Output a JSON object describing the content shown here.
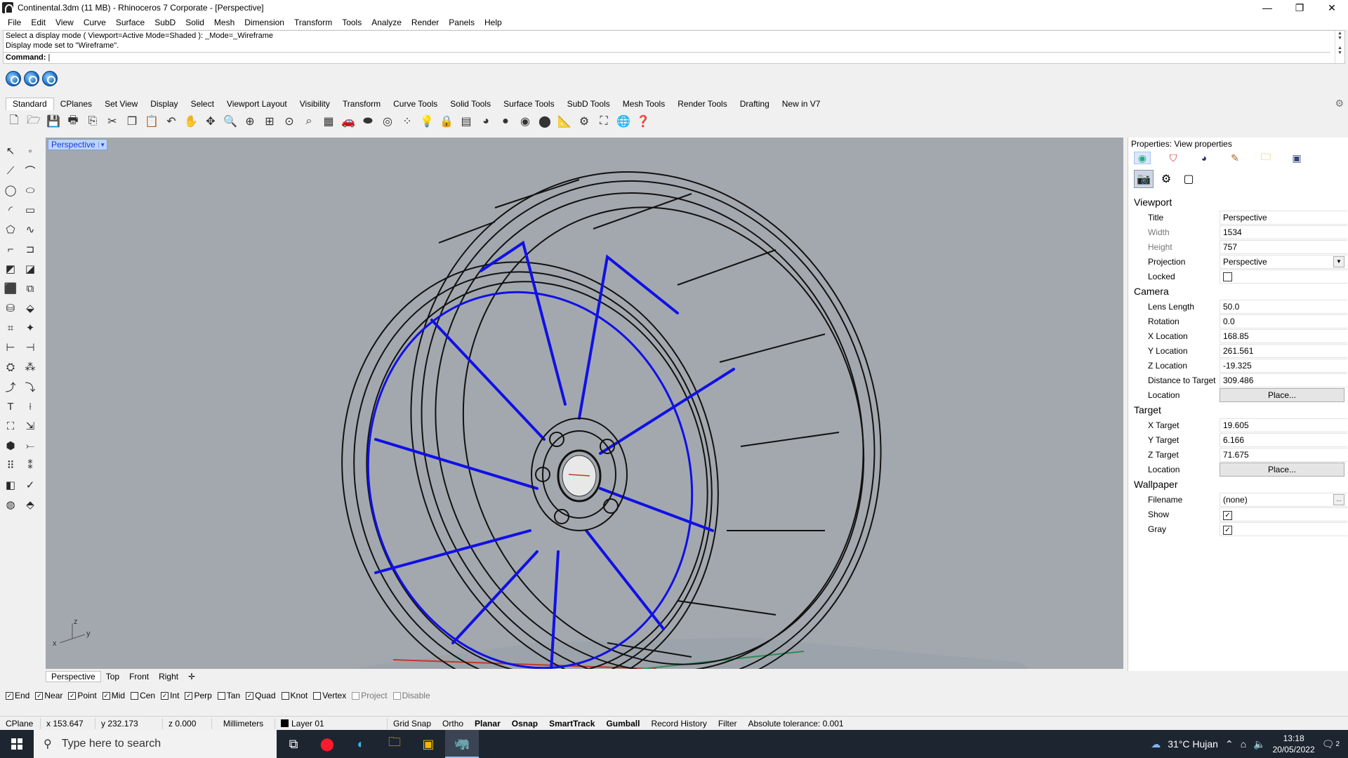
{
  "window": {
    "title": "Continental.3dm (11 MB) - Rhinoceros 7 Corporate - [Perspective]",
    "controls": [
      "—",
      "❐",
      "✕"
    ]
  },
  "menu": [
    "File",
    "Edit",
    "View",
    "Curve",
    "Surface",
    "SubD",
    "Solid",
    "Mesh",
    "Dimension",
    "Transform",
    "Tools",
    "Analyze",
    "Render",
    "Panels",
    "Help"
  ],
  "command": {
    "history": [
      "Select a display mode ( Viewport=Active  Mode=Shaded ): _Mode=_Wireframe",
      "Display mode set to \"Wireframe\"."
    ],
    "prompt": "Command:",
    "value": ""
  },
  "toolbar_tabs": [
    "Standard",
    "CPlanes",
    "Set View",
    "Display",
    "Select",
    "Viewport Layout",
    "Visibility",
    "Transform",
    "Curve Tools",
    "Solid Tools",
    "Surface Tools",
    "SubD Tools",
    "Mesh Tools",
    "Render Tools",
    "Drafting",
    "New in V7"
  ],
  "viewport": {
    "label": "Perspective",
    "axes": {
      "x": "x",
      "y": "y",
      "z": "z"
    }
  },
  "viewport_tabs": [
    "Perspective",
    "Top",
    "Front",
    "Right"
  ],
  "osnaps": [
    {
      "label": "End",
      "checked": true,
      "enabled": true
    },
    {
      "label": "Near",
      "checked": true,
      "enabled": true
    },
    {
      "label": "Point",
      "checked": true,
      "enabled": true
    },
    {
      "label": "Mid",
      "checked": true,
      "enabled": true
    },
    {
      "label": "Cen",
      "checked": false,
      "enabled": true
    },
    {
      "label": "Int",
      "checked": true,
      "enabled": true
    },
    {
      "label": "Perp",
      "checked": true,
      "enabled": true
    },
    {
      "label": "Tan",
      "checked": false,
      "enabled": true
    },
    {
      "label": "Quad",
      "checked": true,
      "enabled": true
    },
    {
      "label": "Knot",
      "checked": false,
      "enabled": true
    },
    {
      "label": "Vertex",
      "checked": false,
      "enabled": true
    },
    {
      "label": "Project",
      "checked": false,
      "enabled": false
    },
    {
      "label": "Disable",
      "checked": false,
      "enabled": false
    }
  ],
  "status": {
    "cplane": "CPlane",
    "x": "x 153.647",
    "y": "y 232.173",
    "z": "z 0.000",
    "units": "Millimeters",
    "layer": "Layer 01",
    "grid_snap": "Grid Snap",
    "ortho": "Ortho",
    "planar": "Planar",
    "osnap": "Osnap",
    "smarttrack": "SmartTrack",
    "gumball": "Gumball",
    "record_history": "Record History",
    "filter": "Filter",
    "tolerance": "Absolute tolerance: 0.001"
  },
  "properties": {
    "title": "Properties: View properties",
    "viewport": {
      "heading": "Viewport",
      "title_label": "Title",
      "title_value": "Perspective",
      "width_label": "Width",
      "width_value": "1534",
      "height_label": "Height",
      "height_value": "757",
      "projection_label": "Projection",
      "projection_value": "Perspective",
      "locked_label": "Locked",
      "locked": false
    },
    "camera": {
      "heading": "Camera",
      "lens_label": "Lens Length",
      "lens_value": "50.0",
      "rotation_label": "Rotation",
      "rotation_value": "0.0",
      "x_label": "X Location",
      "x_value": "168.85",
      "y_label": "Y Location",
      "y_value": "261.561",
      "z_label": "Z Location",
      "z_value": "-19.325",
      "dist_label": "Distance to Target",
      "dist_value": "309.486",
      "loc_label": "Location",
      "place_label": "Place..."
    },
    "target": {
      "heading": "Target",
      "x_label": "X Target",
      "x_value": "19.605",
      "y_label": "Y Target",
      "y_value": "6.166",
      "z_label": "Z Target",
      "z_value": "71.675",
      "loc_label": "Location",
      "place_label": "Place..."
    },
    "wallpaper": {
      "heading": "Wallpaper",
      "filename_label": "Filename",
      "filename_value": "(none)",
      "browse_label": "...",
      "show_label": "Show",
      "show": true,
      "gray_label": "Gray",
      "gray": true
    }
  },
  "taskbar": {
    "search_placeholder": "Type here to search",
    "weather": "31°C  Hujan",
    "time": "13:18",
    "date": "20/05/2022",
    "notifications": "2"
  },
  "colors": {
    "viewport_bg": "#a3a8ae",
    "wire_black": "#111111",
    "wire_blue": "#1010e6",
    "taskbar": "#1d2530"
  }
}
